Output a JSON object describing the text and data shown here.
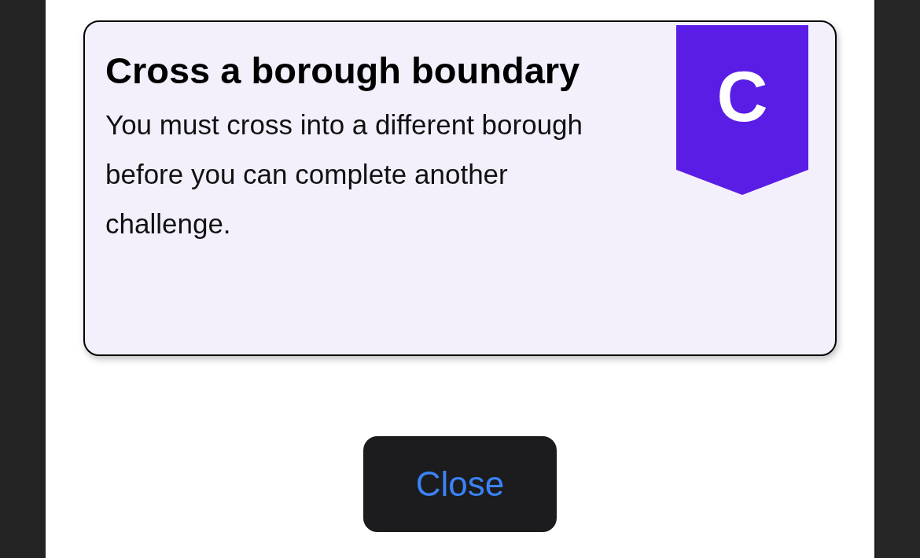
{
  "card": {
    "title": "Cross a borough boundary",
    "description": "You must cross into a different borough before you can complete another challenge.",
    "badge": "C"
  },
  "button": {
    "label": "Close"
  }
}
